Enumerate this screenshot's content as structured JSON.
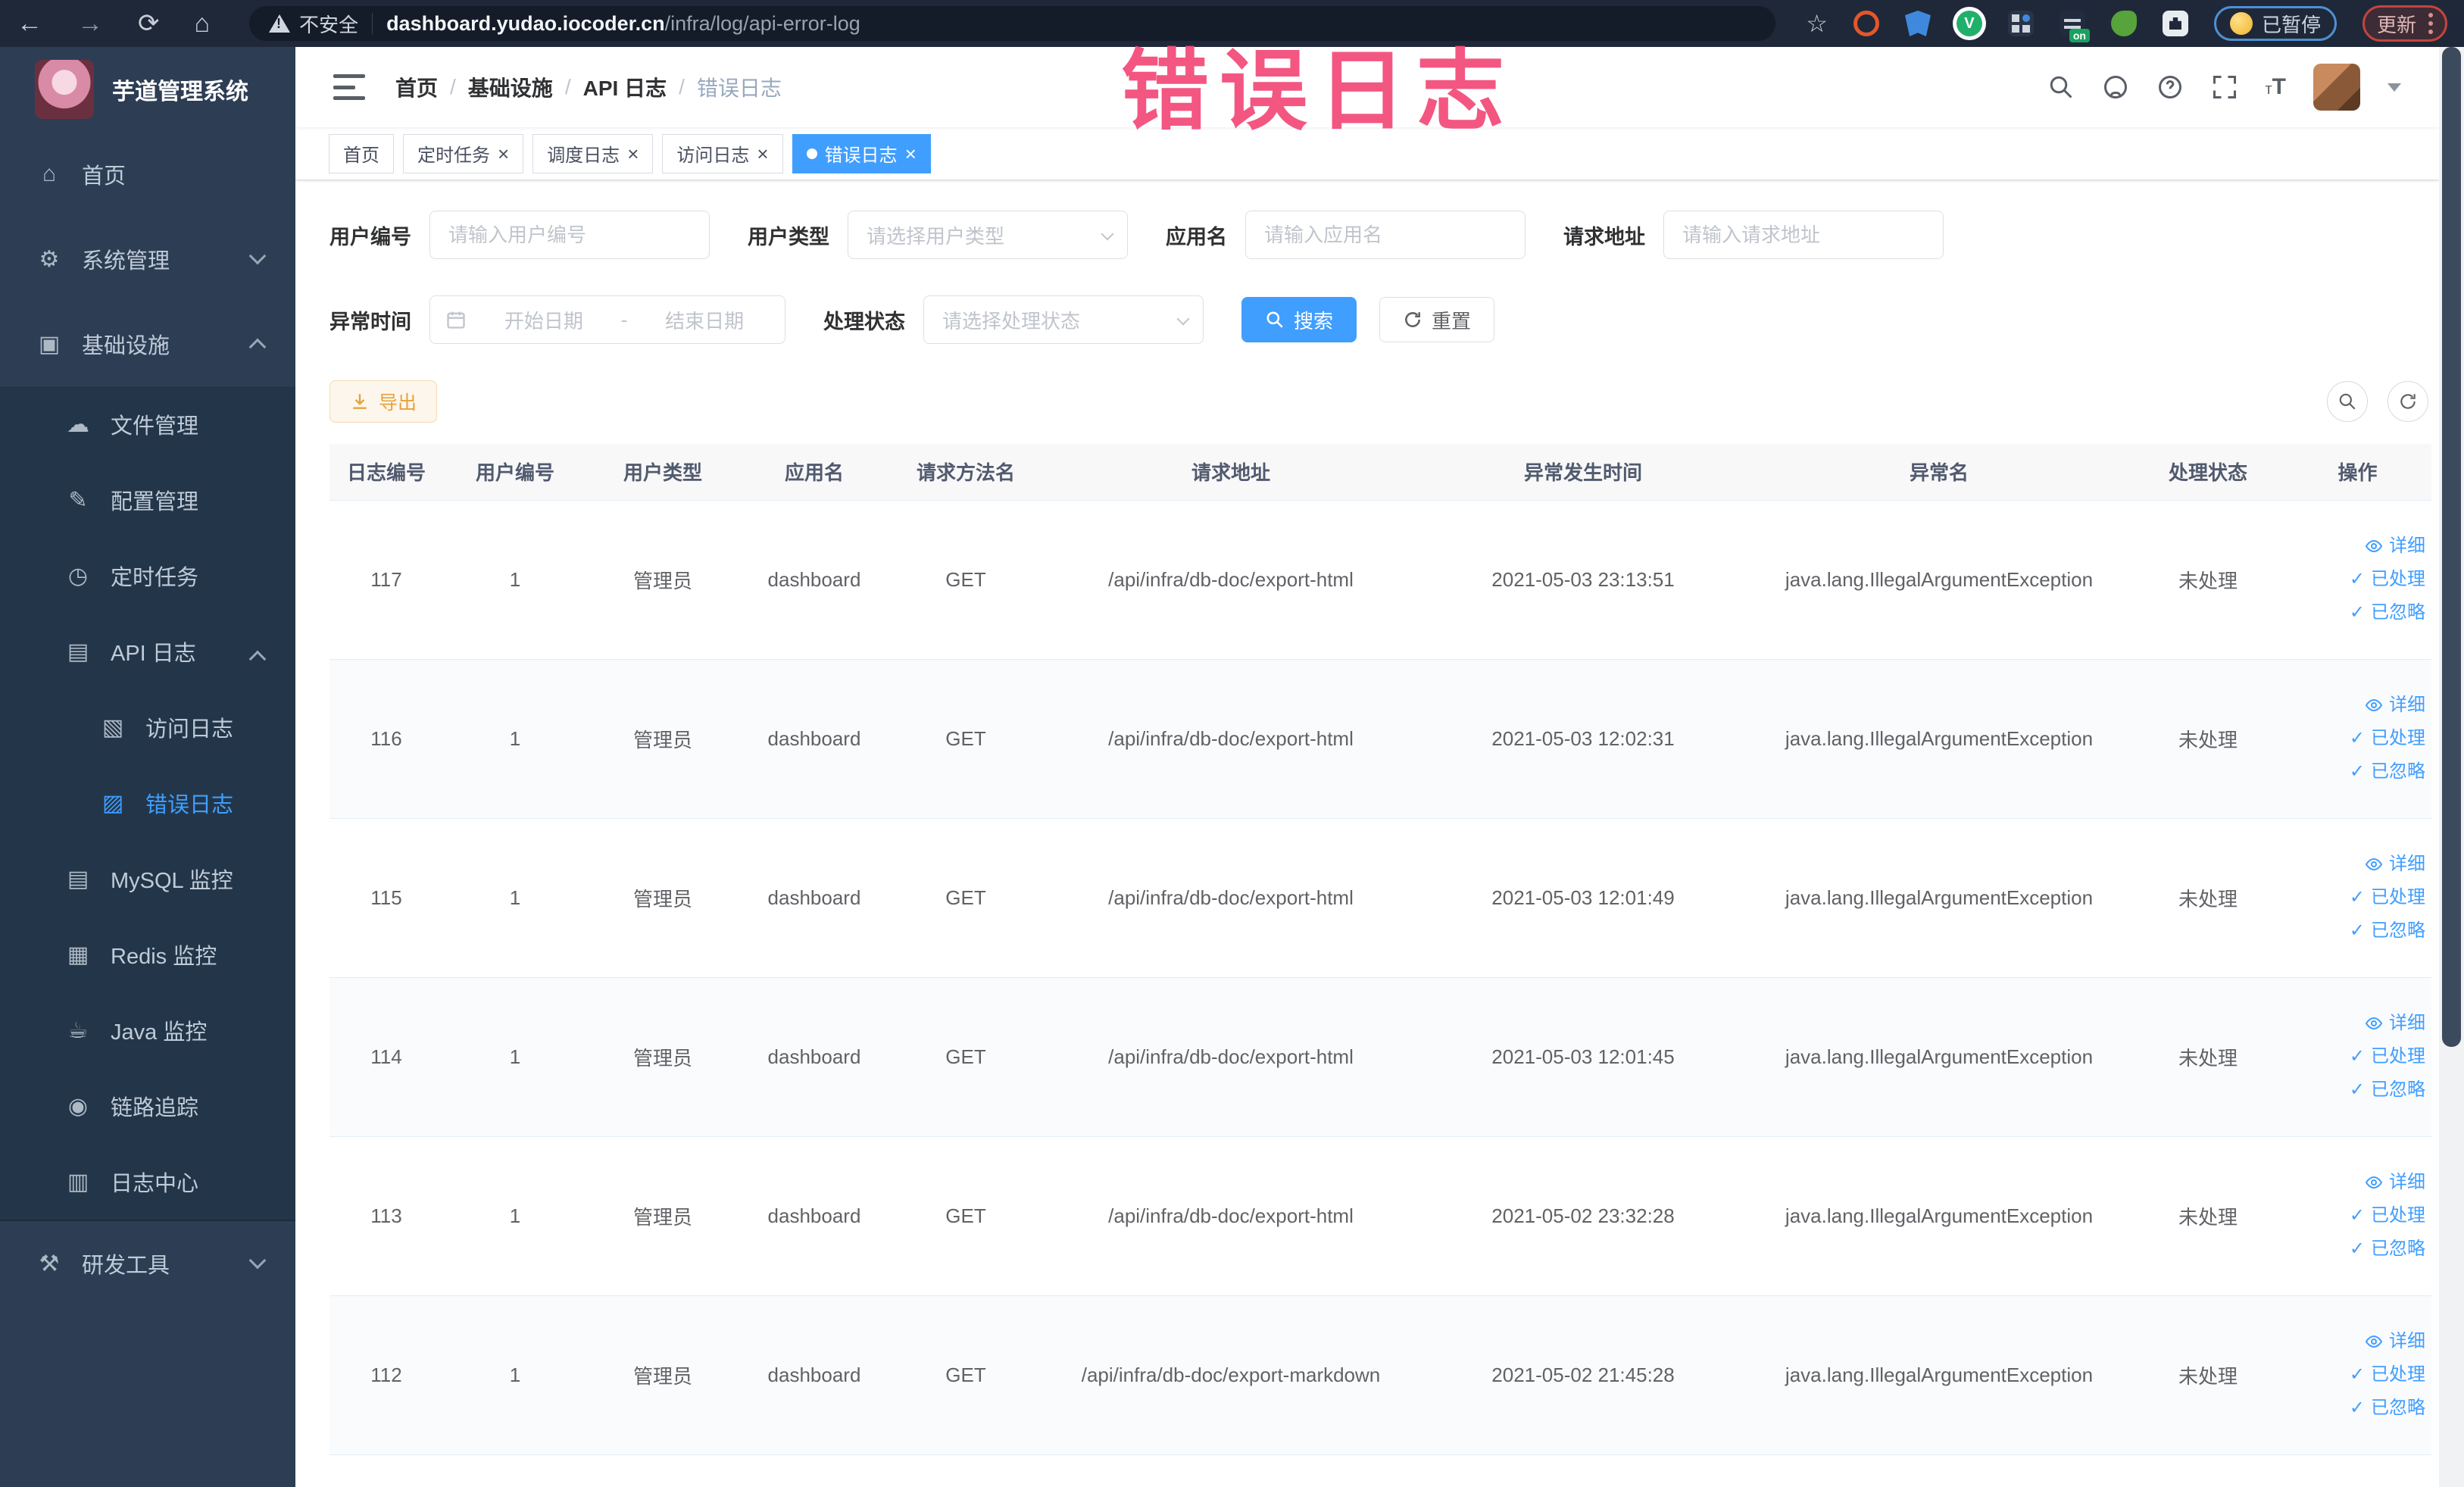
{
  "colors": {
    "accent": "#409eff",
    "warning": "#e6a23c",
    "overlay_pink": "#f24d7a",
    "sidebar_bg": "#2d3e54",
    "submenu_bg": "#233649",
    "browser_bar_bg": "#1f2838"
  },
  "overlay_title": "错误日志",
  "browser": {
    "back": "←",
    "forward": "→",
    "reload": "⟳",
    "home": "⌂",
    "security_label": "不安全",
    "url_host": "dashboard.yudao.iocoder.cn",
    "url_path": "/infra/log/api-error-log",
    "bookmark_star": "☆",
    "extension_v": "V",
    "on_badge": "on",
    "paused_label": "已暂停",
    "update_label": "更新"
  },
  "sidebar": {
    "logo_title": "芋道管理系统",
    "items": [
      {
        "label": "首页",
        "icon": "home-icon",
        "level": 1,
        "glyph": "⌂"
      },
      {
        "label": "系统管理",
        "icon": "gear-icon",
        "level": 1,
        "glyph": "⚙",
        "chevron": "down"
      },
      {
        "label": "基础设施",
        "icon": "monitor-icon",
        "level": 1,
        "glyph": "▣",
        "chevron": "up"
      },
      {
        "label": "文件管理",
        "icon": "cloud-upload-icon",
        "level": 2,
        "glyph": "☁"
      },
      {
        "label": "配置管理",
        "icon": "config-edit-icon",
        "level": 2,
        "glyph": "✎"
      },
      {
        "label": "定时任务",
        "icon": "schedule-icon",
        "level": 2,
        "glyph": "◷"
      },
      {
        "label": "API 日志",
        "icon": "api-log-icon",
        "level": 2,
        "glyph": "▤",
        "chevron": "up"
      },
      {
        "label": "访问日志",
        "icon": "access-log-icon",
        "level": 3,
        "glyph": "▧"
      },
      {
        "label": "错误日志",
        "icon": "error-log-icon",
        "level": 3,
        "glyph": "▨",
        "active": true
      },
      {
        "label": "MySQL 监控",
        "icon": "mysql-icon",
        "level": 2,
        "glyph": "▤"
      },
      {
        "label": "Redis 监控",
        "icon": "redis-icon",
        "level": 2,
        "glyph": "▦"
      },
      {
        "label": "Java 监控",
        "icon": "java-icon",
        "level": 2,
        "glyph": "☕"
      },
      {
        "label": "链路追踪",
        "icon": "trace-icon",
        "level": 2,
        "glyph": "◉"
      },
      {
        "label": "日志中心",
        "icon": "log-center-icon",
        "level": 2,
        "glyph": "▥"
      },
      {
        "label": "研发工具",
        "icon": "dev-tools-icon",
        "level": 1,
        "glyph": "⚒",
        "chevron": "down",
        "divider_before": true
      }
    ]
  },
  "breadcrumb": [
    "首页",
    "基础设施",
    "API 日志",
    "错误日志"
  ],
  "tabs": [
    {
      "label": "首页",
      "closable": false,
      "active": false
    },
    {
      "label": "定时任务",
      "closable": true,
      "active": false
    },
    {
      "label": "调度日志",
      "closable": true,
      "active": false
    },
    {
      "label": "访问日志",
      "closable": true,
      "active": false
    },
    {
      "label": "错误日志",
      "closable": true,
      "active": true
    }
  ],
  "filters": {
    "row1": [
      {
        "label": "用户编号",
        "placeholder": "请输入用户编号",
        "control": "input",
        "name": "user-id"
      },
      {
        "label": "用户类型",
        "placeholder": "请选择用户类型",
        "control": "select",
        "name": "user-type"
      },
      {
        "label": "应用名",
        "placeholder": "请输入应用名",
        "control": "input",
        "name": "app-name"
      },
      {
        "label": "请求地址",
        "placeholder": "请输入请求地址",
        "control": "input",
        "name": "request-url"
      }
    ],
    "row2": {
      "time_label": "异常时间",
      "start_placeholder": "开始日期",
      "separator": "-",
      "end_placeholder": "结束日期",
      "status_label": "处理状态",
      "status_placeholder": "请选择处理状态",
      "search_label": "搜索",
      "reset_label": "重置"
    }
  },
  "toolbar": {
    "export_label": "导出"
  },
  "table": {
    "headers": [
      "日志编号",
      "用户编号",
      "用户类型",
      "应用名",
      "请求方法名",
      "请求地址",
      "异常发生时间",
      "异常名",
      "处理状态",
      "操作"
    ],
    "row_actions": [
      "详细",
      "已处理",
      "已忽略"
    ],
    "rows": [
      {
        "log_id": "117",
        "user_id": "1",
        "user_type": "管理员",
        "app_name": "dashboard",
        "method": "GET",
        "url": "/api/infra/db-doc/export-html",
        "time": "2021-05-03 23:13:51",
        "exception": "java.lang.IllegalArgumentException",
        "status": "未处理"
      },
      {
        "log_id": "116",
        "user_id": "1",
        "user_type": "管理员",
        "app_name": "dashboard",
        "method": "GET",
        "url": "/api/infra/db-doc/export-html",
        "time": "2021-05-03 12:02:31",
        "exception": "java.lang.IllegalArgumentException",
        "status": "未处理"
      },
      {
        "log_id": "115",
        "user_id": "1",
        "user_type": "管理员",
        "app_name": "dashboard",
        "method": "GET",
        "url": "/api/infra/db-doc/export-html",
        "time": "2021-05-03 12:01:49",
        "exception": "java.lang.IllegalArgumentException",
        "status": "未处理"
      },
      {
        "log_id": "114",
        "user_id": "1",
        "user_type": "管理员",
        "app_name": "dashboard",
        "method": "GET",
        "url": "/api/infra/db-doc/export-html",
        "time": "2021-05-03 12:01:45",
        "exception": "java.lang.IllegalArgumentException",
        "status": "未处理"
      },
      {
        "log_id": "113",
        "user_id": "1",
        "user_type": "管理员",
        "app_name": "dashboard",
        "method": "GET",
        "url": "/api/infra/db-doc/export-html",
        "time": "2021-05-02 23:32:28",
        "exception": "java.lang.IllegalArgumentException",
        "status": "未处理"
      },
      {
        "log_id": "112",
        "user_id": "1",
        "user_type": "管理员",
        "app_name": "dashboard",
        "method": "GET",
        "url": "/api/infra/db-doc/export-markdown",
        "time": "2021-05-02 21:45:28",
        "exception": "java.lang.IllegalArgumentException",
        "status": "未处理"
      }
    ]
  }
}
